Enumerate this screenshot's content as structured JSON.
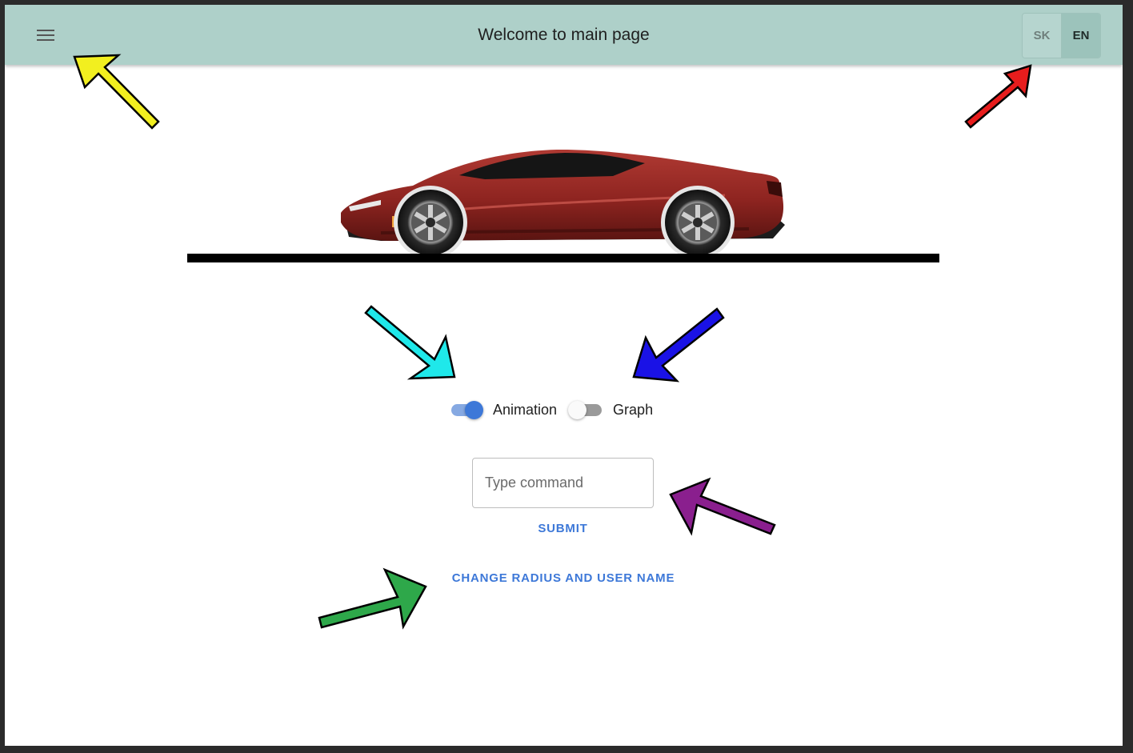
{
  "header": {
    "title": "Welcome to main page",
    "menu_icon": "hamburger-menu-icon",
    "languages": [
      {
        "code": "SK",
        "active": false
      },
      {
        "code": "EN",
        "active": true
      }
    ]
  },
  "scene": {
    "car_icon": "red-sports-car-image"
  },
  "toggles": [
    {
      "label": "Animation",
      "on": true
    },
    {
      "label": "Graph",
      "on": false
    }
  ],
  "command": {
    "placeholder": "Type command",
    "value": "",
    "submit_label": "SUBMIT"
  },
  "settings": {
    "change_label": "CHANGE RADIUS AND USER NAME"
  },
  "colors": {
    "toolbar": "#aed0c9",
    "accent": "#3d78d8",
    "car_body": "#8e2420"
  },
  "annotation_arrows": [
    "yellow",
    "red",
    "cyan",
    "blue",
    "purple",
    "green"
  ]
}
